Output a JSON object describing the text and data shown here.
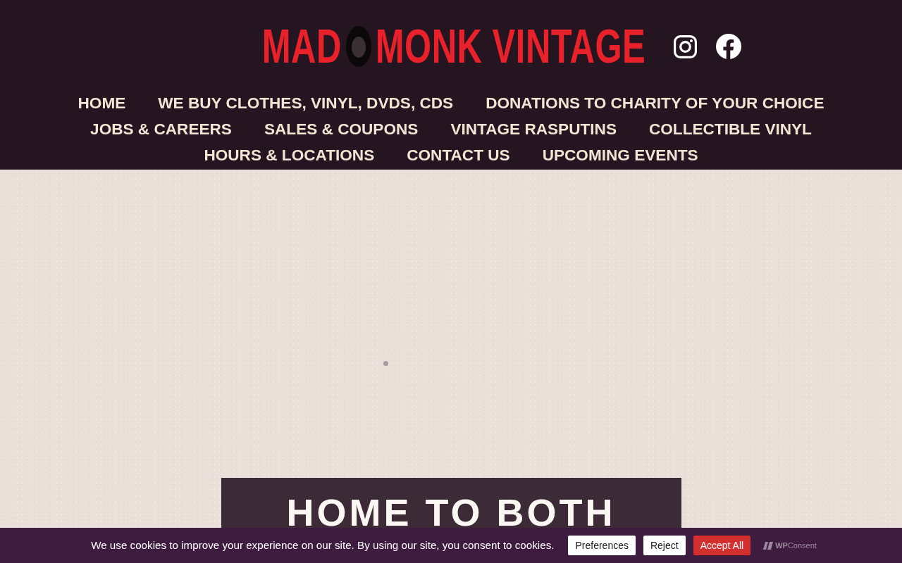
{
  "header": {
    "logo": {
      "words_before": "MAD",
      "words_after": "MONK VINTAGE"
    },
    "social_links": [
      {
        "kind": "instagram"
      },
      {
        "kind": "facebook"
      }
    ]
  },
  "nav": {
    "items": [
      {
        "label": "HOME"
      },
      {
        "label": "WE BUY CLOTHES, VINYL, DVDS, CDS"
      },
      {
        "label": "DONATIONS TO CHARITY OF YOUR CHOICE"
      },
      {
        "label": "JOBS & CAREERS"
      },
      {
        "label": "SALES & COUPONS"
      },
      {
        "label": "VINTAGE RASPUTINS"
      },
      {
        "label": "COLLECTIBLE VINYL"
      },
      {
        "label": "HOURS & LOCATIONS"
      },
      {
        "label": "CONTACT US"
      },
      {
        "label": "UPCOMING EVENTS"
      }
    ]
  },
  "hero": {
    "heading": "HOME TO BOTH"
  },
  "cookie_banner": {
    "message": "We use cookies to improve your experience on our site. By using our site, you consent to cookies.",
    "buttons": [
      {
        "label": "Preferences",
        "kind": "preferences"
      },
      {
        "label": "Reject",
        "kind": "reject"
      },
      {
        "label": "Accept All",
        "kind": "accept"
      }
    ],
    "brand": "**WP**Consent"
  }
}
